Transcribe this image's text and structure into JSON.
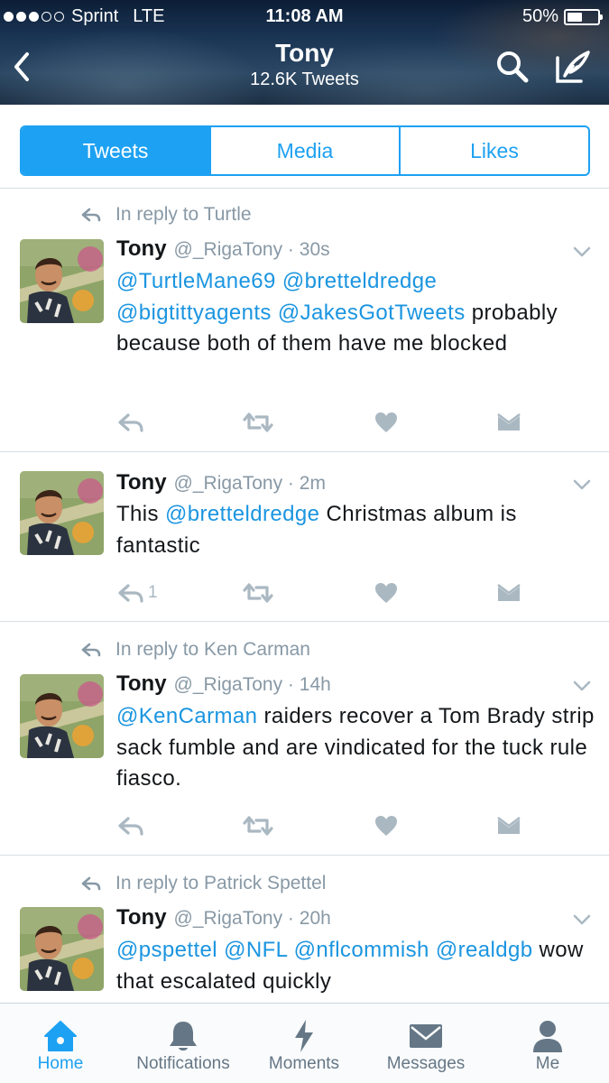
{
  "status_bar": {
    "carrier": "Sprint",
    "network": "LTE",
    "time": "11:08 AM",
    "battery": "50%",
    "battery_level": 0.5
  },
  "header": {
    "name": "Tony",
    "tweet_count": "12.6K Tweets",
    "icons": [
      "chevron-left-icon",
      "search-icon",
      "compose-icon"
    ]
  },
  "tabs": [
    {
      "label": "Tweets",
      "active": true
    },
    {
      "label": "Media",
      "active": false
    },
    {
      "label": "Likes",
      "active": false
    }
  ],
  "tweets": [
    {
      "reply_to": "In reply to Turtle",
      "name": "Tony",
      "handle": "@_RigaTony",
      "time": "30s",
      "segments": [
        {
          "text": "@TurtleMane69",
          "mention": true
        },
        {
          "text": " ",
          "mention": false
        },
        {
          "text": "@bretteldredge",
          "mention": true
        },
        {
          "text": " ",
          "mention": false
        },
        {
          "text": "@bigtittyagents",
          "mention": true
        },
        {
          "text": " ",
          "mention": false
        },
        {
          "text": "@JakesGotTweets",
          "mention": true
        },
        {
          "text": " probably because both of them have me blocked",
          "mention": false
        }
      ],
      "reply_count": ""
    },
    {
      "reply_to": "",
      "name": "Tony",
      "handle": "@_RigaTony",
      "time": "2m",
      "segments": [
        {
          "text": "This ",
          "mention": false
        },
        {
          "text": "@bretteldredge",
          "mention": true
        },
        {
          "text": " Christmas album is fantastic",
          "mention": false
        }
      ],
      "reply_count": "1"
    },
    {
      "reply_to": "In reply to Ken Carman",
      "name": "Tony",
      "handle": "@_RigaTony",
      "time": "14h",
      "segments": [
        {
          "text": "@KenCarman",
          "mention": true
        },
        {
          "text": " raiders recover a Tom Brady strip sack fumble and are vindicated for the tuck rule fiasco.",
          "mention": false
        }
      ],
      "reply_count": ""
    },
    {
      "reply_to": "In reply to Patrick Spettel",
      "name": "Tony",
      "handle": "@_RigaTony",
      "time": "20h",
      "segments": [
        {
          "text": "@pspettel",
          "mention": true
        },
        {
          "text": " ",
          "mention": false
        },
        {
          "text": "@NFL",
          "mention": true
        },
        {
          "text": " ",
          "mention": false
        },
        {
          "text": "@nflcommish",
          "mention": true
        },
        {
          "text": " ",
          "mention": false
        },
        {
          "text": "@realdgb",
          "mention": true
        },
        {
          "text": " wow that escalated quickly",
          "mention": false
        }
      ],
      "reply_count": ""
    }
  ],
  "tabbar": [
    {
      "label": "Home",
      "icon": "home-icon",
      "active": true
    },
    {
      "label": "Notifications",
      "icon": "bell-icon",
      "active": false
    },
    {
      "label": "Moments",
      "icon": "lightning-icon",
      "active": false
    },
    {
      "label": "Messages",
      "icon": "envelope-icon",
      "active": false
    },
    {
      "label": "Me",
      "icon": "person-icon",
      "active": false
    }
  ],
  "colors": {
    "accent": "#1da1f2",
    "mention": "#1b95e0",
    "muted": "#8899a6",
    "icon_gray": "#aab8c2"
  }
}
